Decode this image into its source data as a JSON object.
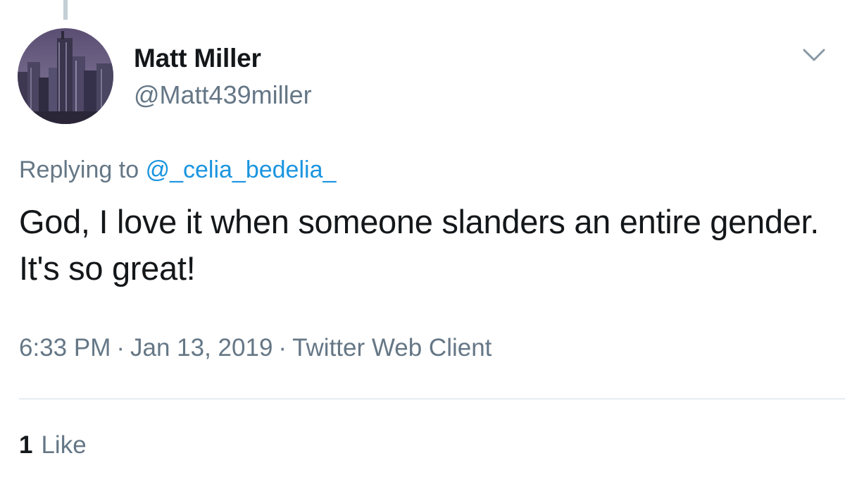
{
  "tweet": {
    "display_name": "Matt Miller",
    "handle": "@Matt439miller",
    "avatar_icon": "city-skyline-avatar",
    "menu_icon": "chevron-down-icon",
    "replying_prefix": "Replying to",
    "replying_to": "@_celia_bedelia_",
    "text": "God, I love it when someone slanders an entire gender. It's so great!",
    "time": "6:33 PM",
    "date": "Jan 13, 2019",
    "separator": "·",
    "client": "Twitter Web Client",
    "like_count": "1",
    "like_label": "Like"
  },
  "colors": {
    "text_primary": "#14171a",
    "text_secondary": "#657786",
    "link": "#1b95e0",
    "divider": "#e6ecf0"
  }
}
